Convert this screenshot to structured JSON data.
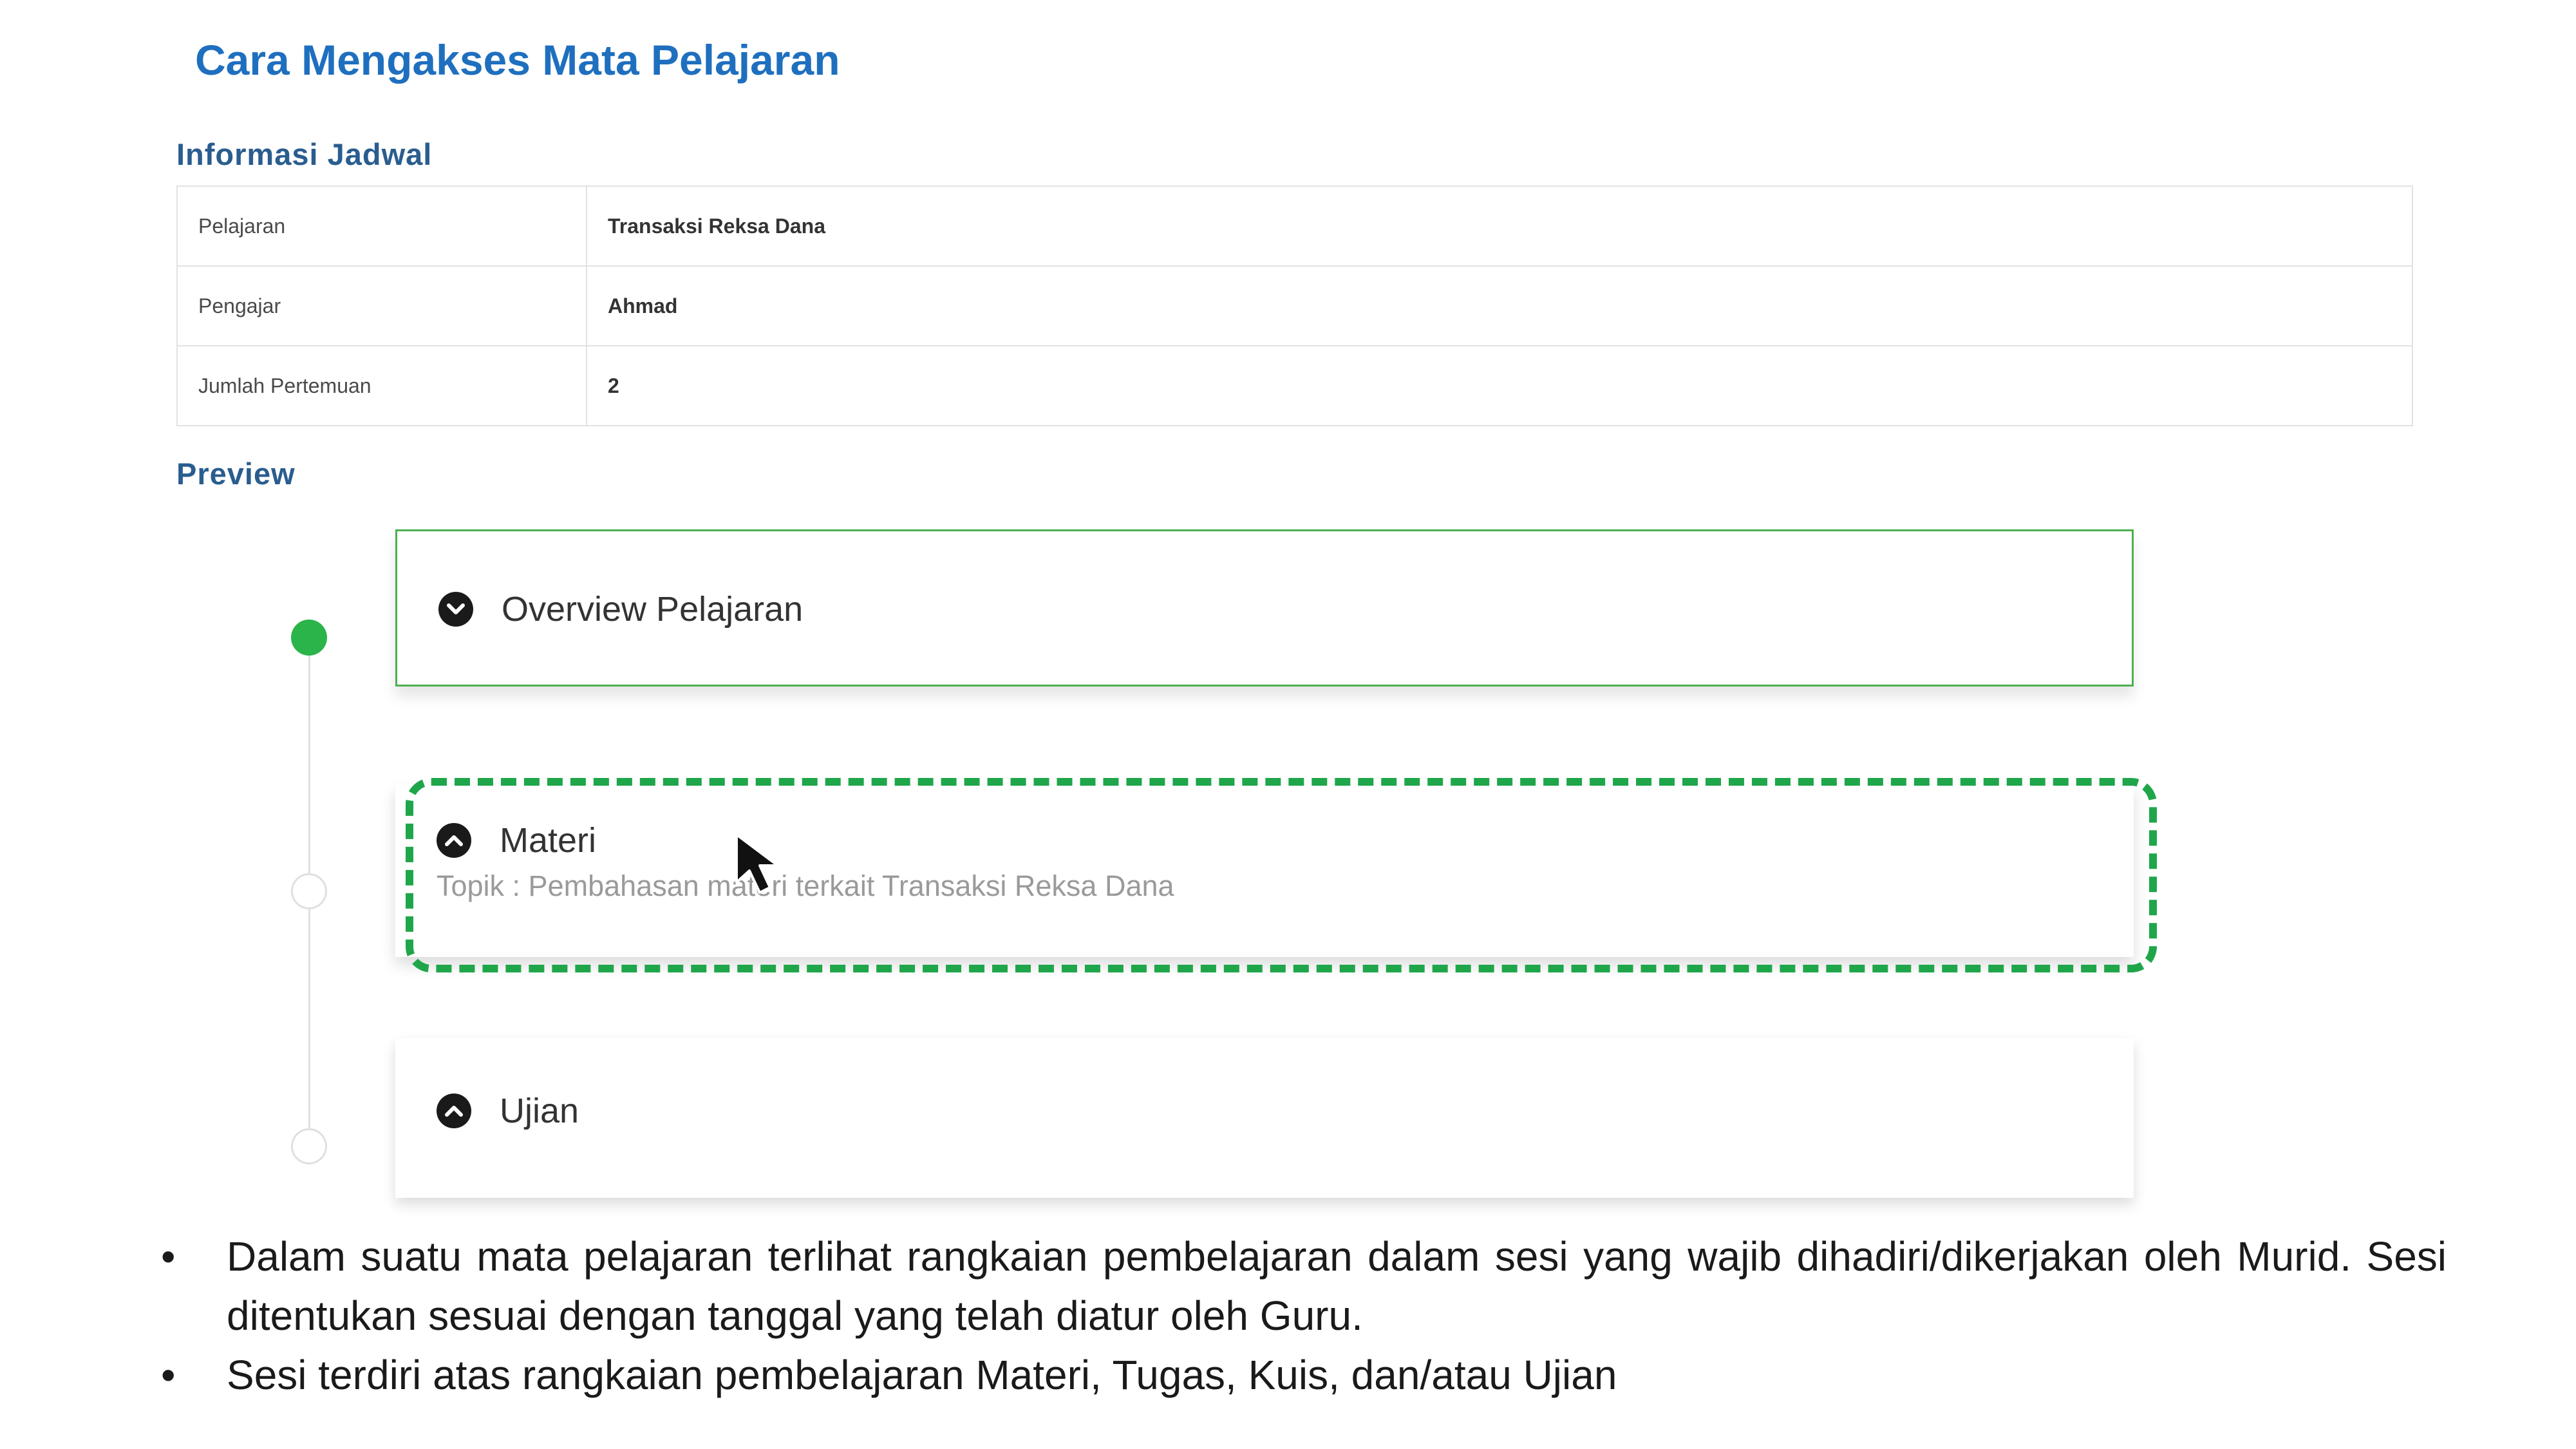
{
  "slide": {
    "title": "Cara Mengakses Mata Pelajaran"
  },
  "schedule": {
    "heading": "Informasi Jadwal",
    "rows": [
      {
        "label": "Pelajaran",
        "value": "Transaksi Reksa Dana"
      },
      {
        "label": "Pengajar",
        "value": "Ahmad"
      },
      {
        "label": "Jumlah Pertemuan",
        "value": "2"
      }
    ]
  },
  "preview": {
    "heading": "Preview",
    "items": [
      {
        "title": "Overview Pelajaran",
        "icon": "chevron-down-circle-icon",
        "status": "completed"
      },
      {
        "title": "Materi",
        "icon": "chevron-up-circle-icon",
        "subtitle": "Topik : Pembahasan materi terkait Transaksi Reksa Dana",
        "status": "pending",
        "highlighted": true
      },
      {
        "title": "Ujian",
        "icon": "chevron-up-circle-icon",
        "status": "pending"
      }
    ]
  },
  "notes": {
    "bullet_symbol": "•",
    "items": [
      "Dalam suatu mata pelajaran terlihat rangkaian pembelajaran dalam sesi yang wajib dihadiri/dikerjakan oleh Murid. Sesi ditentukan sesuai dengan tanggal yang telah diatur oleh Guru.",
      "Sesi terdiri atas rangkaian pembelajaran Materi, Tugas, Kuis, dan/atau Ujian"
    ]
  },
  "colors": {
    "title": "#1f6fbf",
    "heading": "#2a5d8f",
    "active": "#2ab44a",
    "highlight": "#1fa64a",
    "card_border": "#4cb050"
  }
}
